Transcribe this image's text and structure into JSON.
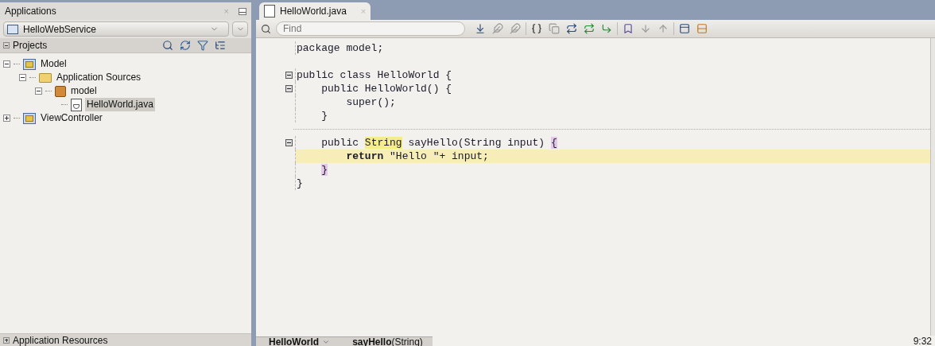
{
  "applications_panel": {
    "title": "Applications",
    "close": "×",
    "app_selector": {
      "value": "HelloWebService"
    },
    "projects_header": "Projects",
    "tree": [
      {
        "label": "Model",
        "kind": "project",
        "expanded": true,
        "selected": false,
        "children": [
          {
            "label": "Application Sources",
            "kind": "folder",
            "expanded": true,
            "selected": false,
            "children": [
              {
                "label": "model",
                "kind": "package",
                "expanded": true,
                "selected": false,
                "children": [
                  {
                    "label": "HelloWorld.java",
                    "kind": "file",
                    "selected": true
                  }
                ]
              }
            ]
          }
        ]
      },
      {
        "label": "ViewController",
        "kind": "project",
        "expanded": false,
        "selected": false
      }
    ],
    "resources_header": "Application Resources"
  },
  "editor": {
    "tabs": [
      {
        "label": "HelloWorld.java",
        "close": "×",
        "selected": true
      }
    ],
    "find": {
      "placeholder": "Find"
    },
    "lines": [
      {
        "kind": "code",
        "fold": false,
        "current": false,
        "tokens": [
          {
            "kind": "plain",
            "text": "package model;"
          }
        ]
      },
      {
        "kind": "blank"
      },
      {
        "kind": "code",
        "fold": true,
        "current": false,
        "tokens": [
          {
            "kind": "plain",
            "text": "public class HelloWorld {"
          }
        ]
      },
      {
        "kind": "code",
        "fold": true,
        "current": false,
        "tokens": [
          {
            "kind": "plain",
            "text": "    public HelloWorld() {"
          }
        ]
      },
      {
        "kind": "code",
        "fold": false,
        "current": false,
        "tokens": [
          {
            "kind": "plain",
            "text": "        super();"
          }
        ]
      },
      {
        "kind": "code",
        "fold": false,
        "current": false,
        "tokens": [
          {
            "kind": "plain",
            "text": "    }"
          }
        ]
      },
      {
        "kind": "separator"
      },
      {
        "kind": "code",
        "fold": true,
        "current": false,
        "tokens": [
          {
            "kind": "plain",
            "text": "    public "
          },
          {
            "kind": "occurrence",
            "text": "String"
          },
          {
            "kind": "plain",
            "text": " sayHello(String input) "
          },
          {
            "kind": "brace_match",
            "text": "{"
          }
        ]
      },
      {
        "kind": "code",
        "fold": false,
        "current": true,
        "tokens": [
          {
            "kind": "keyword",
            "text": "        return"
          },
          {
            "kind": "plain",
            "text": " \"Hello \"+ input;"
          }
        ]
      },
      {
        "kind": "code",
        "fold": false,
        "current": false,
        "tokens": [
          {
            "kind": "brace_match",
            "text": "    }"
          }
        ]
      },
      {
        "kind": "code",
        "fold": false,
        "current": false,
        "tokens": [
          {
            "kind": "plain",
            "text": "}"
          }
        ]
      }
    ],
    "breadcrumbs": [
      {
        "text": "HelloWorld",
        "dropdown": true
      },
      {
        "text": "**sayHello**(String)",
        "dropdown": false
      }
    ],
    "position": "9:32"
  }
}
